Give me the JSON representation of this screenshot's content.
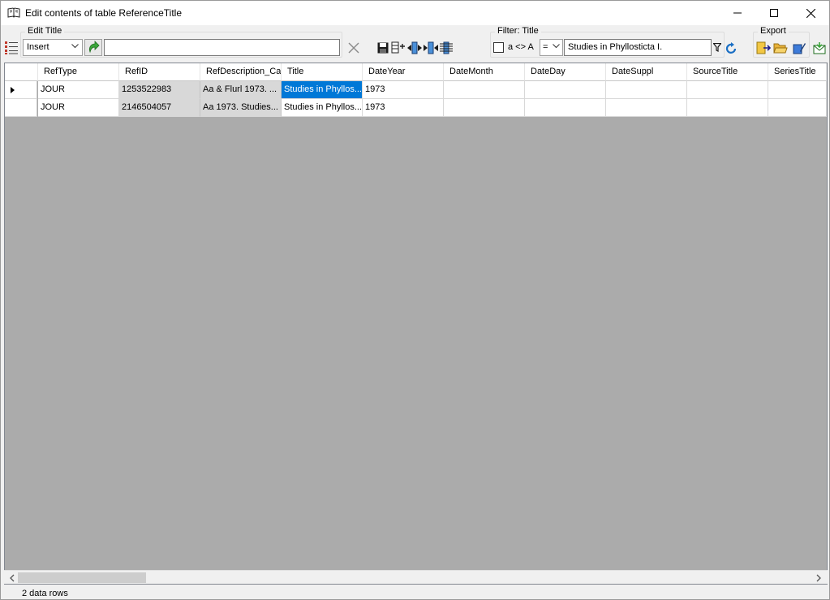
{
  "window": {
    "title": "Edit contents of table ReferenceTitle"
  },
  "edit_group": {
    "label": "Edit Title",
    "mode": "Insert",
    "value": ""
  },
  "filter_group": {
    "label": "Filter: Title",
    "case_label": "a <> A",
    "operator": "=",
    "value": "Studies in Phyllosticta I."
  },
  "export_group": {
    "label": "Export"
  },
  "grid": {
    "columns": [
      "RefType",
      "RefID",
      "RefDescription_Cac",
      "Title",
      "DateYear",
      "DateMonth",
      "DateDay",
      "DateSuppl",
      "SourceTitle",
      "SeriesTitle"
    ],
    "rows": [
      [
        "JOUR",
        "1253522983",
        "Aa & Flurl 1973. ...",
        "Studies in Phyllos...",
        "1973",
        "",
        "",
        "",
        "",
        ""
      ],
      [
        "JOUR",
        "2146504057",
        "Aa 1973. Studies...",
        "Studies in Phyllos...",
        "1973",
        "",
        "",
        "",
        "",
        ""
      ]
    ]
  },
  "status": {
    "text": "2 data rows"
  },
  "colors": {
    "selection": "#0078d7",
    "grid_background": "#ababab",
    "readonly_cell": "#d8d8d8"
  }
}
